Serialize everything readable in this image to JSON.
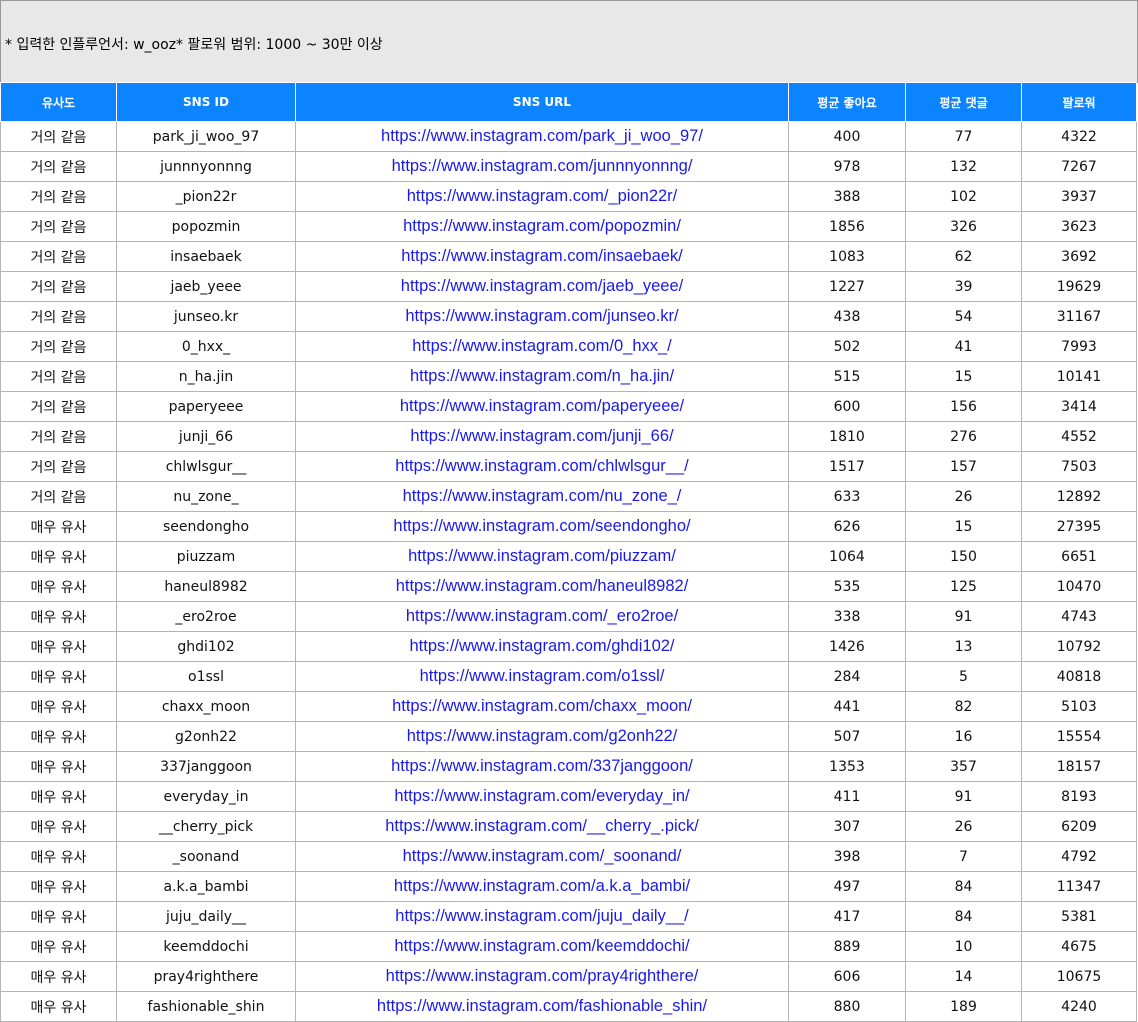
{
  "info_text": "* 입력한 인플루언서: w_ooz* 팔로워 범위: 1000 ~ 30만 이상",
  "columns": [
    "유사도",
    "SNS ID",
    "SNS URL",
    "평균 좋아요",
    "평균 댓글",
    "팔로워"
  ],
  "rows": [
    [
      "거의 같음",
      "park_ji_woo_97",
      "https://www.instagram.com/park_ji_woo_97/",
      "400",
      "77",
      "4322"
    ],
    [
      "거의 같음",
      "junnnyonnng",
      "https://www.instagram.com/junnnyonnng/",
      "978",
      "132",
      "7267"
    ],
    [
      "거의 같음",
      "_pion22r",
      "https://www.instagram.com/_pion22r/",
      "388",
      "102",
      "3937"
    ],
    [
      "거의 같음",
      "popozmin",
      "https://www.instagram.com/popozmin/",
      "1856",
      "326",
      "3623"
    ],
    [
      "거의 같음",
      "insaebaek",
      "https://www.instagram.com/insaebaek/",
      "1083",
      "62",
      "3692"
    ],
    [
      "거의 같음",
      "jaeb_yeee",
      "https://www.instagram.com/jaeb_yeee/",
      "1227",
      "39",
      "19629"
    ],
    [
      "거의 같음",
      "junseo.kr",
      "https://www.instagram.com/junseo.kr/",
      "438",
      "54",
      "31167"
    ],
    [
      "거의 같음",
      "0_hxx_",
      "https://www.instagram.com/0_hxx_/",
      "502",
      "41",
      "7993"
    ],
    [
      "거의 같음",
      "n_ha.jin",
      "https://www.instagram.com/n_ha.jin/",
      "515",
      "15",
      "10141"
    ],
    [
      "거의 같음",
      "paperyeee",
      "https://www.instagram.com/paperyeee/",
      "600",
      "156",
      "3414"
    ],
    [
      "거의 같음",
      "junji_66",
      "https://www.instagram.com/junji_66/",
      "1810",
      "276",
      "4552"
    ],
    [
      "거의 같음",
      "chlwlsgur__",
      "https://www.instagram.com/chlwlsgur__/",
      "1517",
      "157",
      "7503"
    ],
    [
      "거의 같음",
      "nu_zone_",
      "https://www.instagram.com/nu_zone_/",
      "633",
      "26",
      "12892"
    ],
    [
      "매우 유사",
      "seendongho",
      "https://www.instagram.com/seendongho/",
      "626",
      "15",
      "27395"
    ],
    [
      "매우 유사",
      "piuzzam",
      "https://www.instagram.com/piuzzam/",
      "1064",
      "150",
      "6651"
    ],
    [
      "매우 유사",
      "haneul8982",
      "https://www.instagram.com/haneul8982/",
      "535",
      "125",
      "10470"
    ],
    [
      "매우 유사",
      "_ero2roe",
      "https://www.instagram.com/_ero2roe/",
      "338",
      "91",
      "4743"
    ],
    [
      "매우 유사",
      "ghdi102",
      "https://www.instagram.com/ghdi102/",
      "1426",
      "13",
      "10792"
    ],
    [
      "매우 유사",
      "o1ssl",
      "https://www.instagram.com/o1ssl/",
      "284",
      "5",
      "40818"
    ],
    [
      "매우 유사",
      "chaxx_moon",
      "https://www.instagram.com/chaxx_moon/",
      "441",
      "82",
      "5103"
    ],
    [
      "매우 유사",
      "g2onh22",
      "https://www.instagram.com/g2onh22/",
      "507",
      "16",
      "15554"
    ],
    [
      "매우 유사",
      "337janggoon",
      "https://www.instagram.com/337janggoon/",
      "1353",
      "357",
      "18157"
    ],
    [
      "매우 유사",
      "everyday_in",
      "https://www.instagram.com/everyday_in/",
      "411",
      "91",
      "8193"
    ],
    [
      "매우 유사",
      "__cherry_pick",
      "https://www.instagram.com/__cherry_.pick/",
      "307",
      "26",
      "6209"
    ],
    [
      "매우 유사",
      "_soonand",
      "https://www.instagram.com/_soonand/",
      "398",
      "7",
      "4792"
    ],
    [
      "매우 유사",
      "a.k.a_bambi",
      "https://www.instagram.com/a.k.a_bambi/",
      "497",
      "84",
      "11347"
    ],
    [
      "매우 유사",
      "juju_daily__",
      "https://www.instagram.com/juju_daily__/",
      "417",
      "84",
      "5381"
    ],
    [
      "매우 유사",
      "keemddochi",
      "https://www.instagram.com/keemddochi/",
      "889",
      "10",
      "4675"
    ],
    [
      "매우 유사",
      "pray4righthere",
      "https://www.instagram.com/pray4righthere/",
      "606",
      "14",
      "10675"
    ],
    [
      "매우 유사",
      "fashionable_shin",
      "https://www.instagram.com/fashionable_shin/",
      "880",
      "189",
      "4240"
    ]
  ],
  "colors": {
    "header_bg": "#0c84ff",
    "link": "#1a1ae6",
    "info_bg": "#e8e8e8"
  }
}
